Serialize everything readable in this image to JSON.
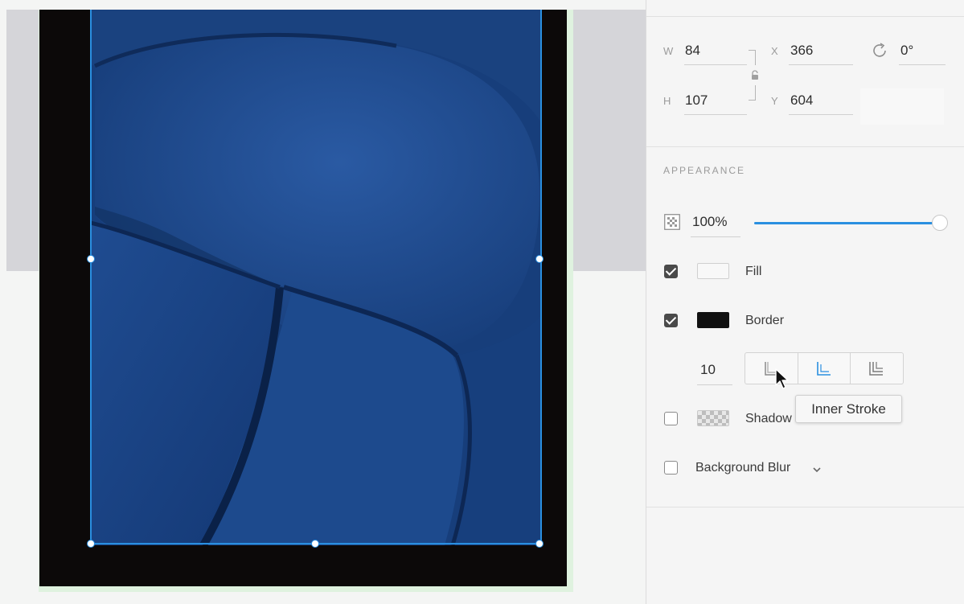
{
  "transform": {
    "width_label": "W",
    "width_value": "84",
    "height_label": "H",
    "height_value": "107",
    "x_label": "X",
    "x_value": "366",
    "y_label": "Y",
    "y_value": "604",
    "rotation_value": "0°"
  },
  "appearance": {
    "section_title": "APPEARANCE",
    "opacity_value": "100%",
    "opacity_level": 1.0,
    "fill": {
      "checked": true,
      "label": "Fill",
      "color": "#f8f8f8"
    },
    "border": {
      "checked": true,
      "label": "Border",
      "color": "#111111",
      "width_value": "10"
    },
    "shadow": {
      "checked": false,
      "label": "Shadow"
    },
    "background_blur": {
      "checked": false,
      "label": "Background Blur"
    }
  },
  "tooltip": {
    "text": "Inner Stroke"
  },
  "colors": {
    "accent": "#2a8fe0",
    "artboard_dark": "#0c0909",
    "photo_blue": "#1d4b8f"
  },
  "icons": [
    "lock-icon",
    "rotate-icon",
    "opacity-icon",
    "outer-stroke-icon",
    "inner-stroke-icon",
    "center-stroke-icon",
    "chevron-down-icon",
    "cursor-icon"
  ]
}
